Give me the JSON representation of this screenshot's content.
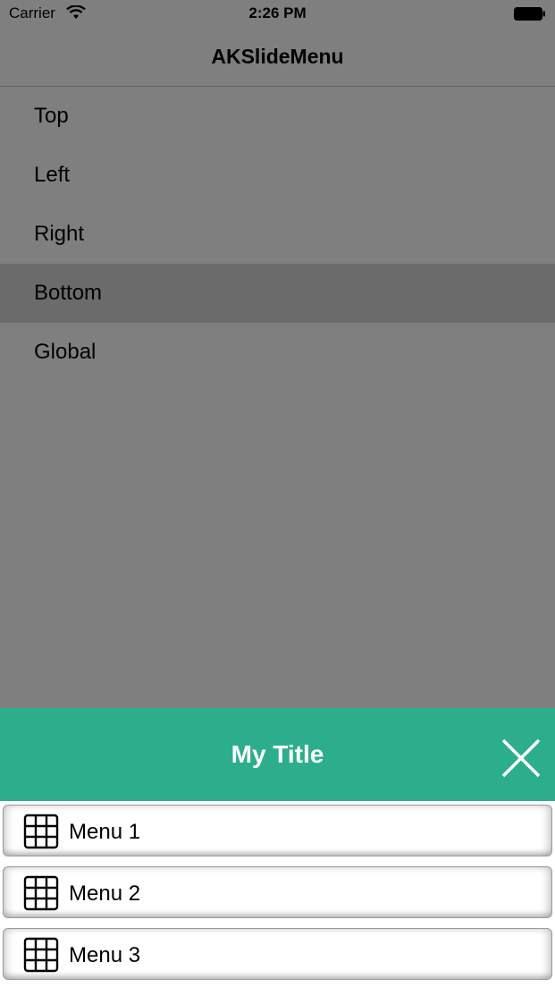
{
  "status": {
    "carrier": "Carrier",
    "time": "2:26 PM"
  },
  "nav": {
    "title": "AKSlideMenu"
  },
  "menu": {
    "items": [
      {
        "label": "Top"
      },
      {
        "label": "Left"
      },
      {
        "label": "Right"
      },
      {
        "label": "Bottom",
        "selected": true
      },
      {
        "label": "Global"
      }
    ]
  },
  "sheet": {
    "title": "My Title",
    "header_color": "#2cae8c",
    "close_icon": "close-icon",
    "items": [
      {
        "label": "Menu 1",
        "icon": "grid-icon"
      },
      {
        "label": "Menu 2",
        "icon": "grid-icon"
      },
      {
        "label": "Menu 3",
        "icon": "grid-icon"
      }
    ]
  }
}
